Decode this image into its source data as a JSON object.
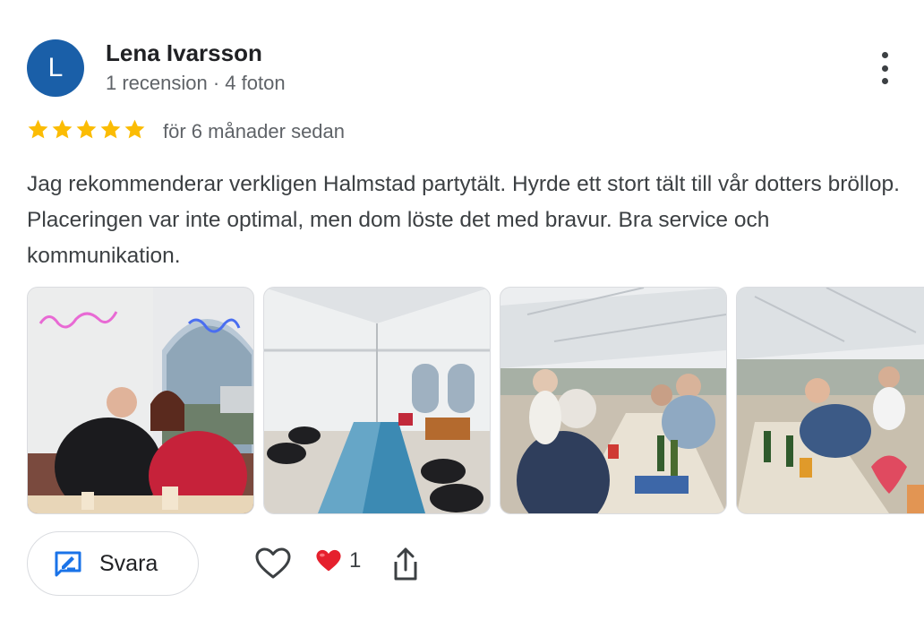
{
  "reviewer": {
    "avatar_initial": "L",
    "avatar_color": "#1a5fa8",
    "name": "Lena Ivarsson",
    "meta": "1 recension · 4 foton"
  },
  "rating": {
    "stars": 5,
    "max": 5,
    "star_color": "#fbbc04"
  },
  "time_ago": "för 6 månader sedan",
  "review_text": "Jag rekommenderar verkligen Halmstad partytält. Hyrde ett stort tält till vår dotters bröllop. Placeringen var inte optimal, men dom löste det med bravur. Bra service och kommunikation.",
  "photos": [
    {
      "name": "photo-couple-neon-sign"
    },
    {
      "name": "photo-tent-long-table"
    },
    {
      "name": "photo-guests-dining"
    },
    {
      "name": "photo-guests-dining-2"
    }
  ],
  "actions": {
    "reply_label": "Svara",
    "reply_icon": "reply-icon",
    "like_icon": "heart-outline-icon",
    "reaction_icon": "red-heart-emoji",
    "reaction_count": "1",
    "share_icon": "share-icon",
    "menu_icon": "more-vertical-icon"
  }
}
